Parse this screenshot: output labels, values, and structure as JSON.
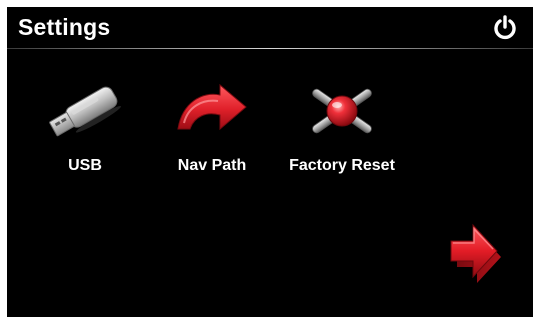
{
  "header": {
    "title": "Settings",
    "power_icon": "power-icon"
  },
  "tiles": [
    {
      "label": "USB",
      "icon": "usb-drive-icon"
    },
    {
      "label": "Nav Path",
      "icon": "curved-arrow-icon"
    },
    {
      "label": "Factory Reset",
      "icon": "factory-reset-icon"
    }
  ],
  "navigation": {
    "next_icon": "next-page-arrow-icon"
  },
  "colors": {
    "background": "#000000",
    "text": "#ffffff",
    "accent_red": "#e0202a"
  }
}
